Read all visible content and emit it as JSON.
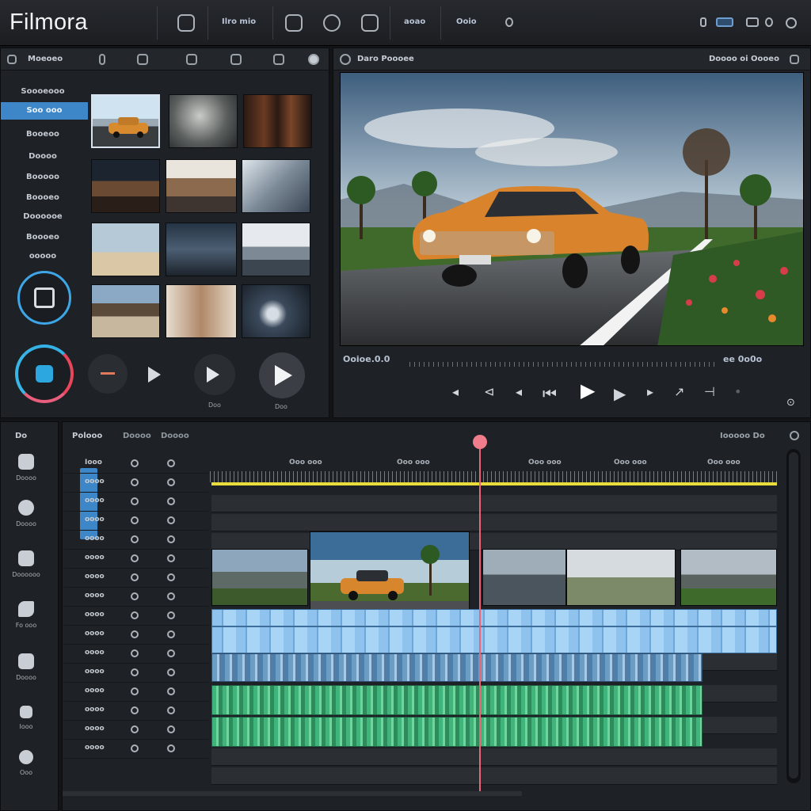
{
  "app": {
    "name": "Filmora"
  },
  "topbar": {
    "tabs": [
      "Ilro mio",
      "aoao",
      "Ooio"
    ]
  },
  "media": {
    "header_label": "Moeoeo",
    "categories": [
      "Soooeooo",
      "Soo ooo",
      "Booeoo",
      "Doooo",
      "Booooo",
      "Boooeo",
      "Doooooe",
      "Boooeo",
      "ooooo"
    ],
    "playback_labels": [
      "Doo",
      "Doo"
    ]
  },
  "preview": {
    "header_label": "Daro Poooee",
    "header_right": "Doooo oi Oooeo",
    "timecode_left": "Ooioe.0.0",
    "timecode_right": "ee 0o0o"
  },
  "tools": {
    "top_label": "Do",
    "items": [
      "Doooo",
      "Doooo",
      "Doooooo",
      "Fo ooo",
      "Doooo",
      "Iooo",
      "Ooo"
    ]
  },
  "timeline": {
    "title": "Polooo",
    "title_tabs": [
      "Doooo",
      "Doooo"
    ],
    "right_label": "Iooooo Do",
    "ruler_labels": [
      "Ooo ooo",
      "Ooo ooo",
      "Ooo ooo",
      "Ooo ooo",
      "Ooo ooo"
    ],
    "track_heads": [
      "Iooo",
      "oooo",
      "oooo",
      "oooo",
      "oooo",
      "oooo",
      "oooo",
      "oooo",
      "oooo",
      "oooo",
      "oooo",
      "oooo",
      "oooo",
      "oooo",
      "oooo",
      "oooo"
    ]
  },
  "colors": {
    "accent": "#3d87c9",
    "playhead": "#e86676",
    "audio_blue": "#8fc3ee",
    "audio_green": "#3fb57c",
    "yellow_marker": "#e8dd3a"
  }
}
